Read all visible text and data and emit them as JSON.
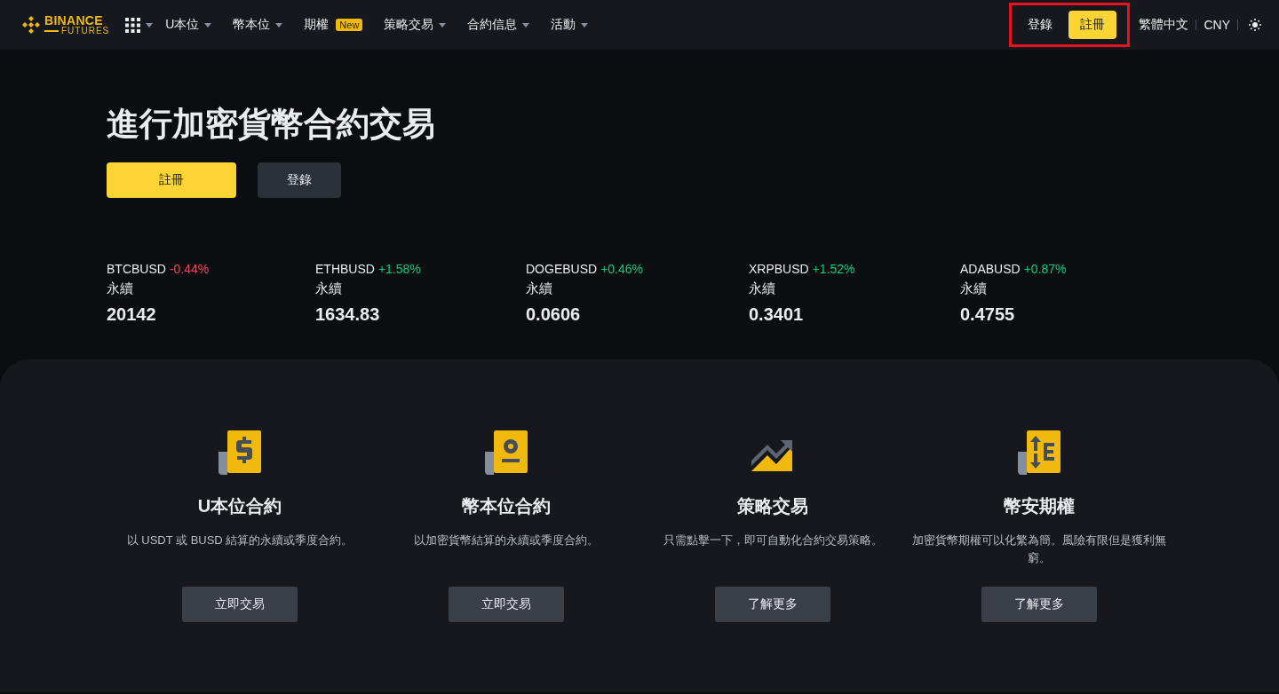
{
  "header": {
    "logo": {
      "brand": "BINANCE",
      "product": "FUTURES"
    },
    "nav": [
      {
        "label": "U本位",
        "dropdown": true
      },
      {
        "label": "幣本位",
        "dropdown": true
      },
      {
        "label": "期權",
        "dropdown": false,
        "badge": "New"
      },
      {
        "label": "策略交易",
        "dropdown": true
      },
      {
        "label": "合約信息",
        "dropdown": true
      },
      {
        "label": "活動",
        "dropdown": true
      }
    ],
    "login": "登錄",
    "register": "註冊",
    "highlighted": true,
    "language": "繁體中文",
    "currency": "CNY"
  },
  "hero": {
    "title": "進行加密貨幣合約交易",
    "register": "註冊",
    "login": "登錄"
  },
  "tickers": [
    {
      "symbol": "BTCBUSD",
      "change": "-0.44%",
      "color": "#f6465d",
      "type": "永續",
      "price": "20142"
    },
    {
      "symbol": "ETHBUSD",
      "change": "+1.58%",
      "color": "#0ecb81",
      "type": "永續",
      "price": "1634.83"
    },
    {
      "symbol": "DOGEBUSD",
      "change": "+0.46%",
      "color": "#0ecb81",
      "type": "永續",
      "price": "0.0606"
    },
    {
      "symbol": "XRPBUSD",
      "change": "+1.52%",
      "color": "#0ecb81",
      "type": "永續",
      "price": "0.3401"
    },
    {
      "symbol": "ADABUSD",
      "change": "+0.87%",
      "color": "#0ecb81",
      "type": "永續",
      "price": "0.4755"
    }
  ],
  "products": [
    {
      "kind": "dollar",
      "title": "U本位合約",
      "description": "以 USDT 或 BUSD 結算的永續或季度合約。",
      "button": "立即交易"
    },
    {
      "kind": "coin",
      "title": "幣本位合約",
      "description": "以加密貨幣結算的永續或季度合約。",
      "button": "立即交易"
    },
    {
      "kind": "chart",
      "title": "策略交易",
      "description": "只需點擊一下，即可自動化合約交易策略。",
      "button": "了解更多"
    },
    {
      "kind": "options",
      "title": "幣安期權",
      "description": "加密貨幣期權可以化繁為簡。風險有限但是獲利無窮。",
      "button": "了解更多"
    }
  ]
}
